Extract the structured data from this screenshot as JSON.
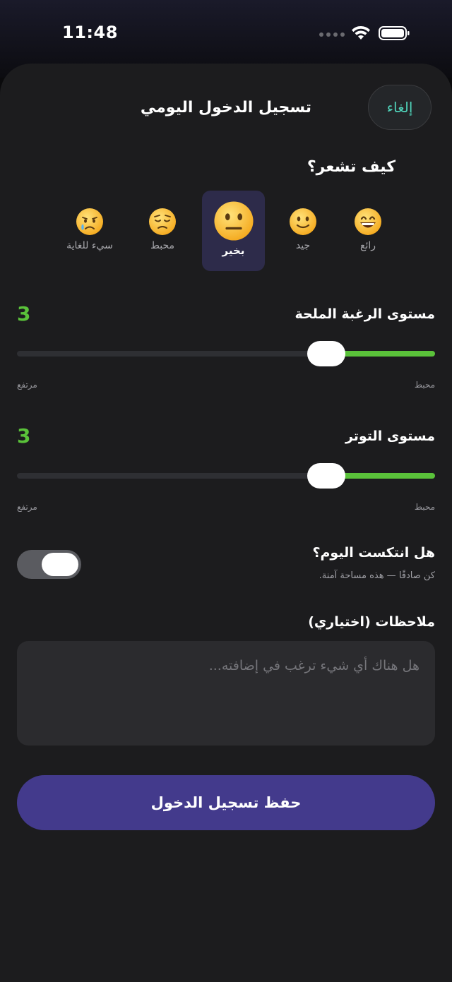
{
  "status_bar": {
    "time": "11:48"
  },
  "header": {
    "title": "تسجيل الدخول اليومي",
    "cancel_label": "إلغاء"
  },
  "mood": {
    "question": "كيف تشعر؟",
    "selected": "بخير",
    "options": [
      {
        "label": "رائع",
        "emoji": "grinning-face-icon"
      },
      {
        "label": "جيد",
        "emoji": "slightly-smiling-face-icon"
      },
      {
        "label": "بخير",
        "emoji": "neutral-face-icon"
      },
      {
        "label": "محبط",
        "emoji": "pensive-face-icon"
      },
      {
        "label": "سيء للغاية",
        "emoji": "crying-face-icon"
      }
    ]
  },
  "craving": {
    "label": "مستوى الرغبة الملحة",
    "value": "3",
    "fraction": 0.26,
    "low_label": "محبط",
    "high_label": "مرتفع"
  },
  "stress": {
    "label": "مستوى التوتر",
    "value": "3",
    "fraction": 0.26,
    "low_label": "محبط",
    "high_label": "مرتفع"
  },
  "relapse": {
    "question": "هل انتكست اليوم؟",
    "subtitle": "كن صادقًا — هذه مساحة آمنة.",
    "toggle_on": true
  },
  "notes": {
    "label": "ملاحظات (اختياري)",
    "placeholder": "هل هناك أي شيء ترغب في إضافته..."
  },
  "save_button": {
    "label": "حفظ تسجيل الدخول"
  },
  "colors": {
    "accent_green": "#5ac23a",
    "accent_teal": "#4fd1b8",
    "primary_purple": "#433a8c",
    "selected_mood_bg": "#2d2b4a"
  }
}
